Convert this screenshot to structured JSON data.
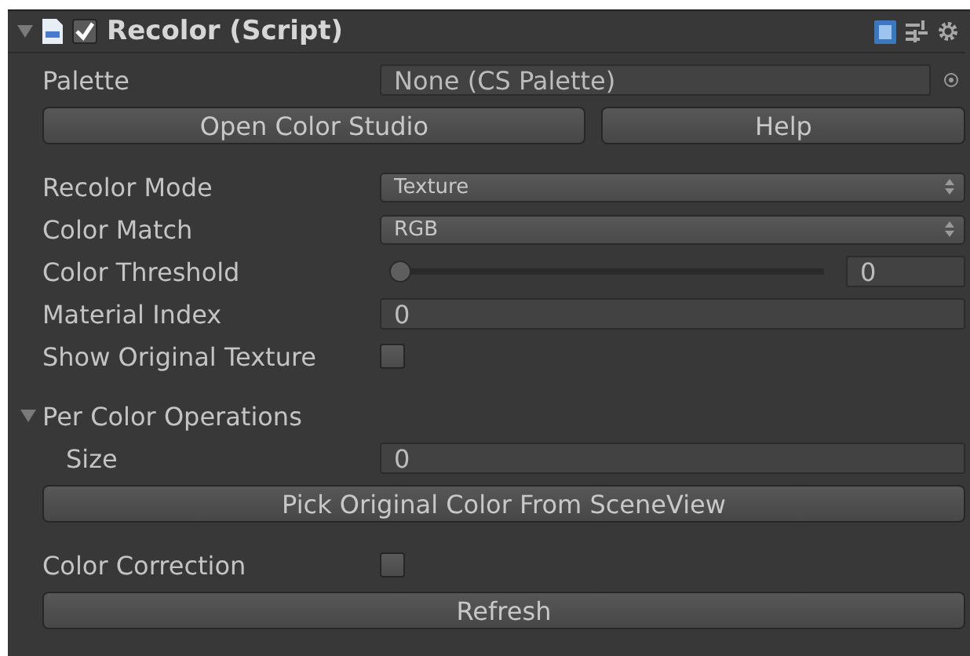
{
  "header": {
    "title": "Recolor (Script)",
    "expanded": true,
    "enabled": true
  },
  "fields": [
    {
      "kind": "object",
      "label": "Palette",
      "value": "None (CS Palette)"
    },
    {
      "kind": "buttons",
      "buttons": [
        "Open Color Studio",
        "Help"
      ]
    },
    {
      "kind": "popup",
      "label": "Recolor Mode",
      "value": "Texture"
    },
    {
      "kind": "popup",
      "label": "Color Match",
      "value": "RGB"
    },
    {
      "kind": "slider",
      "label": "Color Threshold",
      "value": "0",
      "level": 0
    },
    {
      "kind": "number",
      "label": "Material Index",
      "value": "0"
    },
    {
      "kind": "checkbox",
      "label": "Show Original Texture",
      "checked": false
    },
    {
      "kind": "foldout",
      "label": "Per Color Operations",
      "expanded": true,
      "children": [
        {
          "kind": "number",
          "label": "Size",
          "value": "0"
        }
      ]
    },
    {
      "kind": "button",
      "label": "Pick Original Color From SceneView"
    },
    {
      "kind": "checkbox",
      "label": "Color Correction",
      "checked": false
    },
    {
      "kind": "button",
      "label": "Refresh"
    }
  ]
}
